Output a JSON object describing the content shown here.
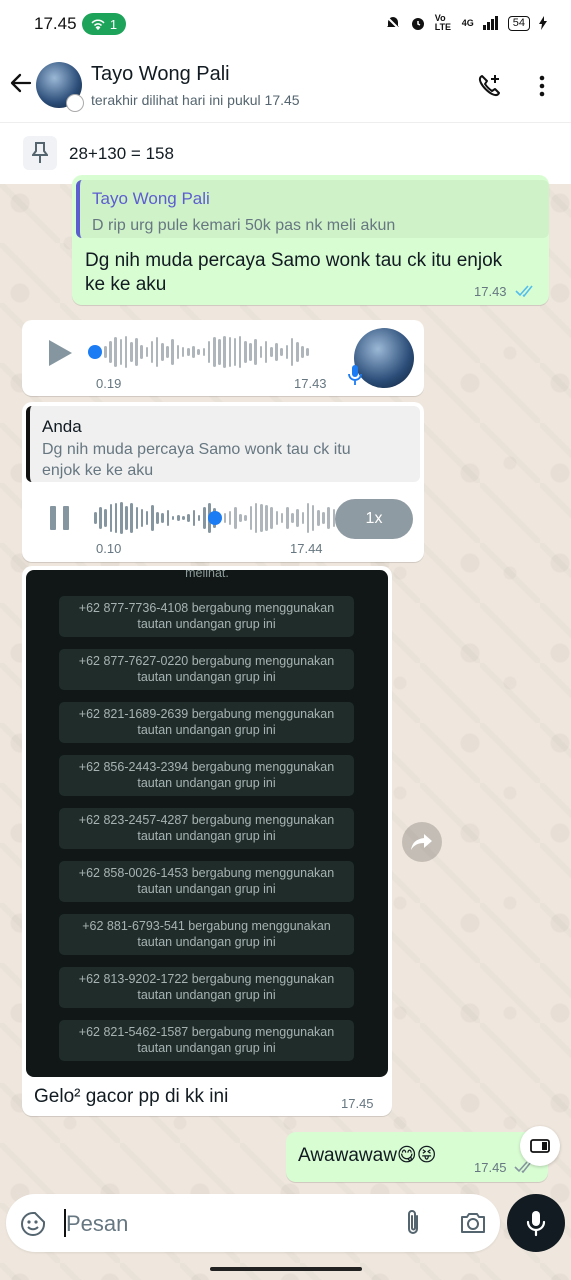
{
  "status_bar": {
    "time": "17.45",
    "hotspot_count": "1",
    "network_label": "4G",
    "volte_label": "Vo LTE",
    "battery": "54"
  },
  "header": {
    "contact_name": "Tayo Wong Pali",
    "last_seen": "terakhir dilihat hari ini pukul 17.45"
  },
  "pinned": {
    "text": "28+130 = 158"
  },
  "messages": {
    "reply_out": {
      "quote_author": "Tayo Wong Pali",
      "quote_text": "D rip urg pule kemari 50k pas nk meli akun",
      "text_line1": "Dg nih muda percaya Samo wonk tau ck itu enjok",
      "text_line2": "ke ke aku",
      "time": "17.43"
    },
    "voice_in": {
      "duration": "0.19",
      "time": "17.43"
    },
    "voice_out": {
      "quote_author": "Anda",
      "quote_text_line1": "Dg nih muda percaya Samo wonk tau ck itu",
      "quote_text_line2": "enjok ke ke aku",
      "duration": "0.10",
      "time": "17.44",
      "speed": "1x"
    },
    "image_in": {
      "top_text": "melihat.",
      "system_rows": [
        {
          "line1": "+62 877-7736-4108 bergabung menggunakan",
          "line2": "tautan undangan grup ini"
        },
        {
          "line1": "+62 877-7627-0220 bergabung menggunakan",
          "line2": "tautan undangan grup ini"
        },
        {
          "line1": "+62 821-1689-2639 bergabung menggunakan",
          "line2": "tautan undangan grup ini"
        },
        {
          "line1": "+62 856-2443-2394 bergabung menggunakan",
          "line2": "tautan undangan grup ini"
        },
        {
          "line1": "+62 823-2457-4287 bergabung menggunakan",
          "line2": "tautan undangan grup ini"
        },
        {
          "line1": "+62 858-0026-1453 bergabung menggunakan",
          "line2": "tautan undangan grup ini"
        },
        {
          "line1": "+62 881-6793-541 bergabung menggunakan",
          "line2": "tautan undangan grup ini"
        },
        {
          "line1": "+62 813-9202-1722 bergabung menggunakan",
          "line2": "tautan undangan grup ini"
        },
        {
          "line1": "+62 821-5462-1587 bergabung menggunakan",
          "line2": "tautan undangan grup ini"
        }
      ],
      "caption": "Gelo² gacor pp di kk ini",
      "time": "17.45"
    },
    "text_out": {
      "text": "Awawawaw😋😝",
      "time": "17.45"
    }
  },
  "input": {
    "placeholder": "Pesan"
  },
  "colors": {
    "outgoing_bubble": "#d9fdd3",
    "incoming_bubble": "#ffffff",
    "read_ticks": "#53bdeb",
    "voice_dot": "#1c7cf4",
    "wallpaper": "#efe7dd"
  }
}
